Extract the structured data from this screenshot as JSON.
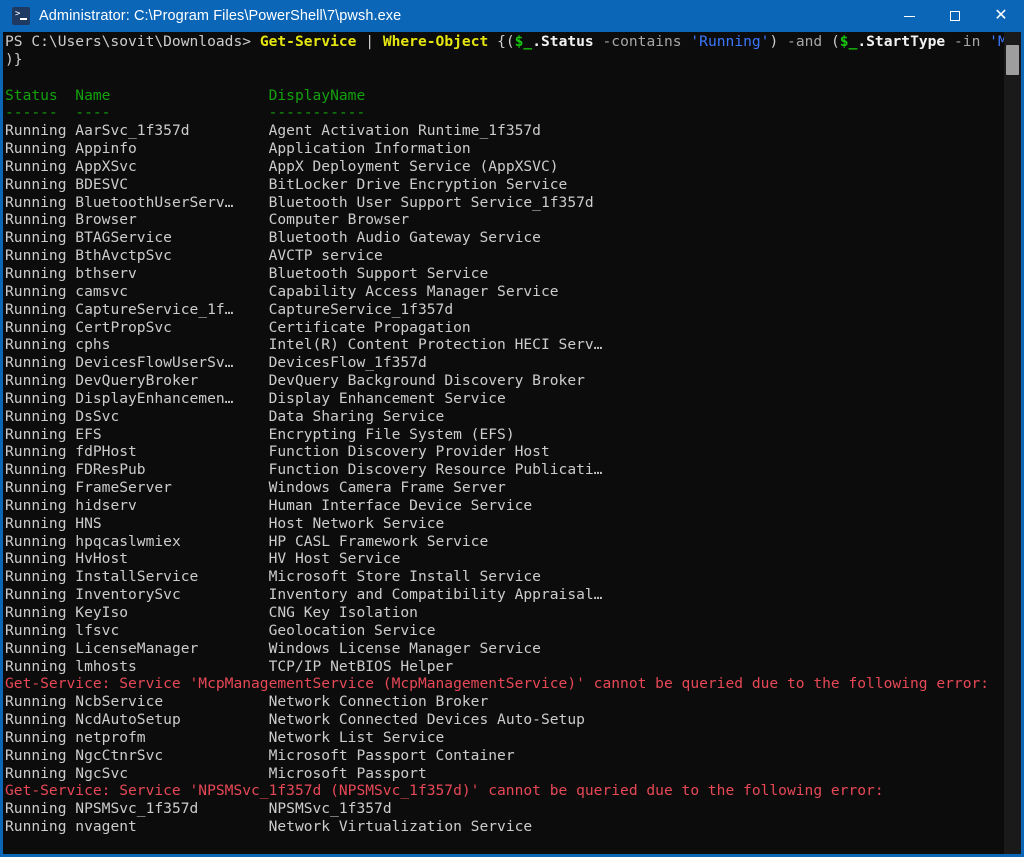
{
  "window": {
    "title": "Administrator: C:\\Program Files\\PowerShell\\7\\pwsh.exe",
    "icon": "powershell-icon",
    "accent_color": "#0b66b8",
    "background_color": "#0c0c0c",
    "controls": {
      "minimize": "minimize-button",
      "maximize": "maximize-button",
      "close": "close-button",
      "close_glyph": "✕"
    }
  },
  "terminal": {
    "prompt": {
      "prefix": "PS ",
      "path": "C:\\Users\\sovit\\Downloads",
      "suffix": "> ",
      "command_segments": [
        {
          "text": "Get-Service ",
          "color": "yellow-bold"
        },
        {
          "text": "| ",
          "color": "default"
        },
        {
          "text": "Where-Object ",
          "color": "yellow-bold"
        },
        {
          "text": "{(",
          "color": "default"
        },
        {
          "text": "$_",
          "color": "green-bold"
        },
        {
          "text": ".Status ",
          "color": "white-bold"
        },
        {
          "text": "-contains ",
          "color": "gray"
        },
        {
          "text": "'Running'",
          "color": "cyan"
        },
        {
          "text": ") ",
          "color": "default"
        },
        {
          "text": "-and ",
          "color": "gray"
        },
        {
          "text": "(",
          "color": "default"
        },
        {
          "text": "$_",
          "color": "green-bold"
        },
        {
          "text": ".StartType ",
          "color": "white-bold"
        },
        {
          "text": "-in ",
          "color": "gray"
        },
        {
          "text": "'Manual'",
          "color": "cyan"
        }
      ],
      "continuation": ")}"
    },
    "table": {
      "headers": {
        "status": "Status",
        "name": "Name",
        "displayname": "DisplayName"
      },
      "rules": {
        "status": "------",
        "name": "----",
        "displayname": "-----------"
      },
      "column_widths": {
        "status": 8,
        "name": 22
      },
      "rows": [
        {
          "status": "Running",
          "name": "AarSvc_1f357d",
          "displayname": "Agent Activation Runtime_1f357d"
        },
        {
          "status": "Running",
          "name": "Appinfo",
          "displayname": "Application Information"
        },
        {
          "status": "Running",
          "name": "AppXSvc",
          "displayname": "AppX Deployment Service (AppXSVC)"
        },
        {
          "status": "Running",
          "name": "BDESVC",
          "displayname": "BitLocker Drive Encryption Service"
        },
        {
          "status": "Running",
          "name": "BluetoothUserServ…",
          "displayname": "Bluetooth User Support Service_1f357d"
        },
        {
          "status": "Running",
          "name": "Browser",
          "displayname": "Computer Browser"
        },
        {
          "status": "Running",
          "name": "BTAGService",
          "displayname": "Bluetooth Audio Gateway Service"
        },
        {
          "status": "Running",
          "name": "BthAvctpSvc",
          "displayname": "AVCTP service"
        },
        {
          "status": "Running",
          "name": "bthserv",
          "displayname": "Bluetooth Support Service"
        },
        {
          "status": "Running",
          "name": "camsvc",
          "displayname": "Capability Access Manager Service"
        },
        {
          "status": "Running",
          "name": "CaptureService_1f…",
          "displayname": "CaptureService_1f357d"
        },
        {
          "status": "Running",
          "name": "CertPropSvc",
          "displayname": "Certificate Propagation"
        },
        {
          "status": "Running",
          "name": "cphs",
          "displayname": "Intel(R) Content Protection HECI Serv…"
        },
        {
          "status": "Running",
          "name": "DevicesFlowUserSv…",
          "displayname": "DevicesFlow_1f357d"
        },
        {
          "status": "Running",
          "name": "DevQueryBroker",
          "displayname": "DevQuery Background Discovery Broker"
        },
        {
          "status": "Running",
          "name": "DisplayEnhancemen…",
          "displayname": "Display Enhancement Service"
        },
        {
          "status": "Running",
          "name": "DsSvc",
          "displayname": "Data Sharing Service"
        },
        {
          "status": "Running",
          "name": "EFS",
          "displayname": "Encrypting File System (EFS)"
        },
        {
          "status": "Running",
          "name": "fdPHost",
          "displayname": "Function Discovery Provider Host"
        },
        {
          "status": "Running",
          "name": "FDResPub",
          "displayname": "Function Discovery Resource Publicati…"
        },
        {
          "status": "Running",
          "name": "FrameServer",
          "displayname": "Windows Camera Frame Server"
        },
        {
          "status": "Running",
          "name": "hidserv",
          "displayname": "Human Interface Device Service"
        },
        {
          "status": "Running",
          "name": "HNS",
          "displayname": "Host Network Service"
        },
        {
          "status": "Running",
          "name": "hpqcaslwmiex",
          "displayname": "HP CASL Framework Service"
        },
        {
          "status": "Running",
          "name": "HvHost",
          "displayname": "HV Host Service"
        },
        {
          "status": "Running",
          "name": "InstallService",
          "displayname": "Microsoft Store Install Service"
        },
        {
          "status": "Running",
          "name": "InventorySvc",
          "displayname": "Inventory and Compatibility Appraisal…"
        },
        {
          "status": "Running",
          "name": "KeyIso",
          "displayname": "CNG Key Isolation"
        },
        {
          "status": "Running",
          "name": "lfsvc",
          "displayname": "Geolocation Service"
        },
        {
          "status": "Running",
          "name": "LicenseManager",
          "displayname": "Windows License Manager Service"
        },
        {
          "status": "Running",
          "name": "lmhosts",
          "displayname": "TCP/IP NetBIOS Helper"
        },
        {
          "error": "Get-Service: Service 'McpManagementService (McpManagementService)' cannot be queried due to the following error:"
        },
        {
          "status": "Running",
          "name": "NcbService",
          "displayname": "Network Connection Broker"
        },
        {
          "status": "Running",
          "name": "NcdAutoSetup",
          "displayname": "Network Connected Devices Auto-Setup"
        },
        {
          "status": "Running",
          "name": "netprofm",
          "displayname": "Network List Service"
        },
        {
          "status": "Running",
          "name": "NgcCtnrSvc",
          "displayname": "Microsoft Passport Container"
        },
        {
          "status": "Running",
          "name": "NgcSvc",
          "displayname": "Microsoft Passport"
        },
        {
          "error": "Get-Service: Service 'NPSMSvc_1f357d (NPSMSvc_1f357d)' cannot be queried due to the following error:"
        },
        {
          "status": "Running",
          "name": "NPSMSvc_1f357d",
          "displayname": "NPSMSvc_1f357d"
        },
        {
          "status": "Running",
          "name": "nvagent",
          "displayname": "Network Virtualization Service"
        }
      ]
    },
    "colors": {
      "foreground": "#cccccc",
      "header_green": "#13a10e",
      "error_red": "#e74856",
      "command_yellow": "#e5e510",
      "string_cyan": "#3b78ff",
      "parameter_gray": "#a6a6a6"
    },
    "scrollbar": {
      "thumb_color": "#9e9e9e",
      "track_color": "#1a1a1a"
    }
  }
}
